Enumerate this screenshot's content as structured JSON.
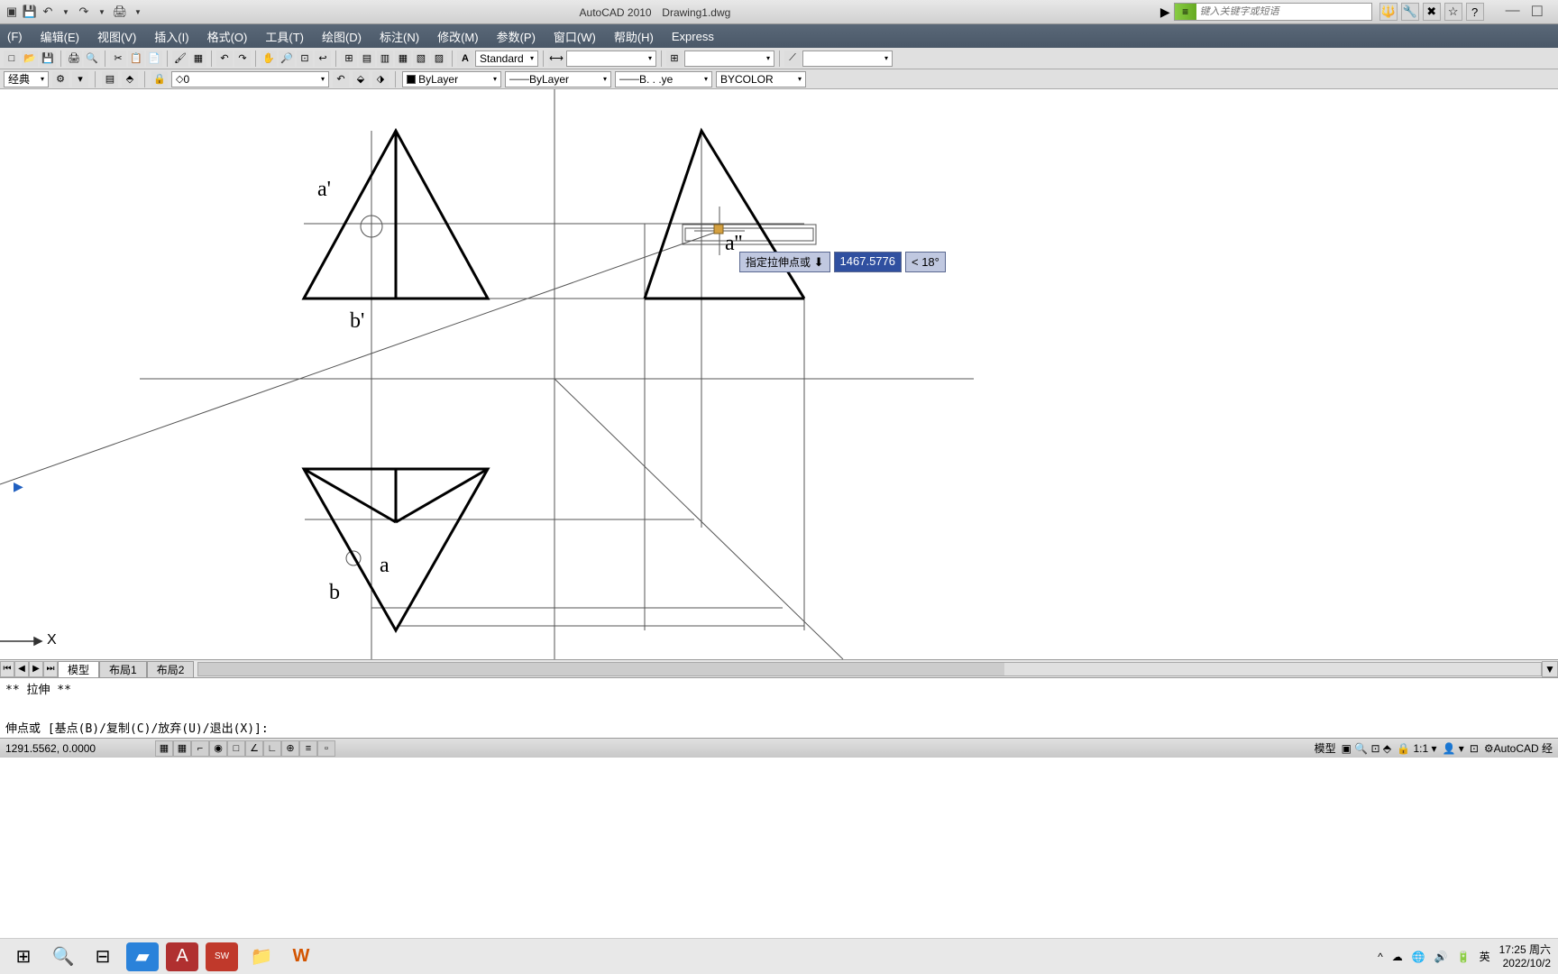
{
  "title": {
    "app": "AutoCAD 2010",
    "file": "Drawing1.dwg"
  },
  "search": {
    "placeholder": "键入关键字或短语"
  },
  "menu": {
    "file": "(F)",
    "edit": "编辑(E)",
    "view": "视图(V)",
    "insert": "插入(I)",
    "format": "格式(O)",
    "tools": "工具(T)",
    "draw": "绘图(D)",
    "dimension": "标注(N)",
    "modify": "修改(M)",
    "param": "参数(P)",
    "window": "窗口(W)",
    "help": "帮助(H)",
    "express": "Express"
  },
  "toolbars": {
    "style": "Standard",
    "workspace": "经典",
    "layer": "0",
    "color": "ByLayer",
    "ltype": "ByLayer",
    "lweight": "B. . .ye",
    "plotstyle": "BYCOLOR"
  },
  "canvas": {
    "labels": {
      "a1": "a'",
      "b1": "b'",
      "a": "a",
      "b": "b",
      "a2": "a''"
    },
    "dyn": {
      "prompt": "指定拉伸点或",
      "value": "1467.5776",
      "angle": "< 18°"
    },
    "axis_x": "X"
  },
  "tabs": {
    "model": "模型",
    "layout1": "布局1",
    "layout2": "布局2"
  },
  "command": {
    "hist": "** 拉伸 **",
    "prompt": "伸点或 [基点(B)/复制(C)/放弃(U)/退出(X)]:"
  },
  "status": {
    "coord": "1291.5562, 0.0000",
    "ws": "模型",
    "scale": "1:1",
    "tag": "AutoCAD 经"
  },
  "tray": {
    "ime": "英",
    "time": "17:25 周六",
    "date": "2022/10/2"
  }
}
